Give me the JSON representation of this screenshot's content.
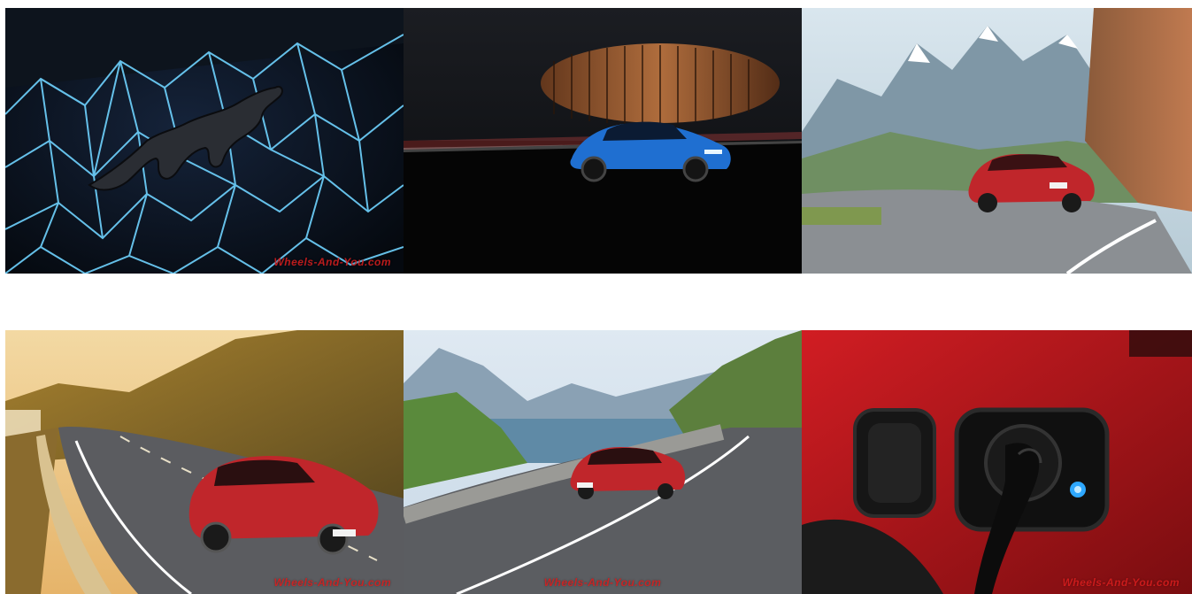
{
  "gallery": {
    "watermark": "Wheels-And-You.com",
    "tiles": [
      {
        "name": "tile-mustang-logo"
      },
      {
        "name": "tile-night-arena"
      },
      {
        "name": "tile-mountain-road"
      },
      {
        "name": "tile-sunset-coast"
      },
      {
        "name": "tile-lake-road"
      },
      {
        "name": "tile-charging-port"
      }
    ]
  }
}
